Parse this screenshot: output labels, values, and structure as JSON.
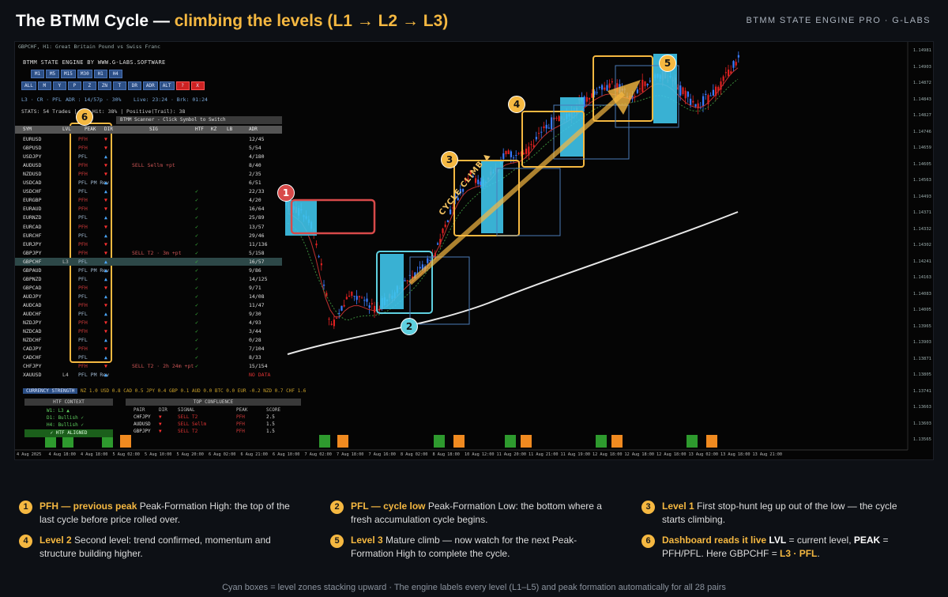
{
  "header": {
    "title_main": "The BTMM Cycle — ",
    "title_accent": "climbing the levels (L1 → L2 → L3)",
    "brand": "BTMM STATE ENGINE PRO · G-LABS"
  },
  "panel": {
    "window_title": "GBPCHF, H1: Great Britain Pound vs Swiss Franc",
    "engine_name": "BTMM STATE ENGINE BY WWW.G-LABS.SOFTWARE",
    "tf_row1": [
      "M1",
      "M5",
      "M15",
      "M30",
      "H1",
      "H4"
    ],
    "tf_row2": [
      "ALL",
      "M",
      "Y",
      "P",
      "Z",
      "ZN",
      "T",
      "DR",
      "ADR",
      "ALT",
      "?",
      "X"
    ],
    "info1": "L3 · CR · PFL",
    "info2": "ADR : 14/57p · 30%",
    "info3": "Live: 23:24 · Brk: 01:24",
    "stats": "STATS: 54 Trades | TP1 Hit: 38% | Positive(Trail): 38",
    "scanner_header": "BTMM Scanner - Click Symbol to Switch",
    "col_headers": [
      "SYM",
      "LVL",
      "PEAK",
      "DIR",
      "SIG",
      "HTF",
      "KZ",
      "LB",
      "ADR"
    ],
    "rows": [
      {
        "sym": "EURUSD",
        "lvl": "",
        "peak": "PFH",
        "dir": "▼",
        "sig": "",
        "htf": "",
        "adr": "12/45"
      },
      {
        "sym": "GBPUSD",
        "lvl": "",
        "peak": "PFH",
        "dir": "▼",
        "sig": "",
        "htf": "",
        "adr": "5/54"
      },
      {
        "sym": "USDJPY",
        "lvl": "",
        "peak": "PFL",
        "dir": "▲",
        "sig": "",
        "htf": "",
        "adr": "4/180"
      },
      {
        "sym": "AUDUSD",
        "lvl": "",
        "peak": "PFH",
        "dir": "▼",
        "sig": "SELL Sellm +pt",
        "htf": "",
        "adr": "8/40"
      },
      {
        "sym": "NZDUSD",
        "lvl": "",
        "peak": "PFH",
        "dir": "▼",
        "sig": "",
        "htf": "",
        "adr": "2/35"
      },
      {
        "sym": "USDCAD",
        "lvl": "",
        "peak": "PFL PM Rev",
        "dir": "▲",
        "sig": "",
        "htf": "",
        "adr": "6/51"
      },
      {
        "sym": "USDCHF",
        "lvl": "",
        "peak": "PFL",
        "dir": "▲",
        "sig": "",
        "htf": "✓",
        "adr": "22/33"
      },
      {
        "sym": "EURGBP",
        "lvl": "",
        "peak": "PFH",
        "dir": "▼",
        "sig": "",
        "htf": "✓",
        "adr": "4/20"
      },
      {
        "sym": "EURAUD",
        "lvl": "",
        "peak": "PFH",
        "dir": "▼",
        "sig": "",
        "htf": "✓",
        "adr": "16/64"
      },
      {
        "sym": "EURNZD",
        "lvl": "",
        "peak": "PFL",
        "dir": "▲",
        "sig": "",
        "htf": "✓",
        "adr": "25/89"
      },
      {
        "sym": "EURCAD",
        "lvl": "",
        "peak": "PFH",
        "dir": "▼",
        "sig": "",
        "htf": "✓",
        "adr": "13/57"
      },
      {
        "sym": "EURCHF",
        "lvl": "",
        "peak": "PFL",
        "dir": "▲",
        "sig": "",
        "htf": "✓",
        "adr": "29/46"
      },
      {
        "sym": "EURJPY",
        "lvl": "",
        "peak": "PFH",
        "dir": "▼",
        "sig": "",
        "htf": "✓",
        "adr": "11/136"
      },
      {
        "sym": "GBPJPY",
        "lvl": "",
        "peak": "PFH",
        "dir": "▼",
        "sig": "SELL T2 · 3m +pt",
        "htf": "✓",
        "adr": "5/158"
      },
      {
        "sym": "GBPCHF",
        "lvl": "L3",
        "peak": "PFL",
        "dir": "▲",
        "sig": "",
        "htf": "✓",
        "adr": "16/57",
        "hl": true
      },
      {
        "sym": "GBPAUD",
        "lvl": "",
        "peak": "PFL PM Rev",
        "dir": "▲",
        "sig": "",
        "htf": "✓",
        "adr": "9/86"
      },
      {
        "sym": "GBPNZD",
        "lvl": "",
        "peak": "PFL",
        "dir": "▲",
        "sig": "",
        "htf": "✓",
        "adr": "14/125"
      },
      {
        "sym": "GBPCAD",
        "lvl": "",
        "peak": "PFH",
        "dir": "▼",
        "sig": "",
        "htf": "✓",
        "adr": "9/71"
      },
      {
        "sym": "AUDJPY",
        "lvl": "",
        "peak": "PFL",
        "dir": "▲",
        "sig": "",
        "htf": "✓",
        "adr": "14/08"
      },
      {
        "sym": "AUDCAD",
        "lvl": "",
        "peak": "PFH",
        "dir": "▼",
        "sig": "",
        "htf": "✓",
        "adr": "11/47"
      },
      {
        "sym": "AUDCHF",
        "lvl": "",
        "peak": "PFL",
        "dir": "▲",
        "sig": "",
        "htf": "✓",
        "adr": "9/30"
      },
      {
        "sym": "NZDJPY",
        "lvl": "",
        "peak": "PFH",
        "dir": "▼",
        "sig": "",
        "htf": "✓",
        "adr": "4/93"
      },
      {
        "sym": "NZDCAD",
        "lvl": "",
        "peak": "PFH",
        "dir": "▼",
        "sig": "",
        "htf": "✓",
        "adr": "3/44"
      },
      {
        "sym": "NZDCHF",
        "lvl": "",
        "peak": "PFL",
        "dir": "▲",
        "sig": "",
        "htf": "✓",
        "adr": "0/28"
      },
      {
        "sym": "CADJPY",
        "lvl": "",
        "peak": "PFH",
        "dir": "▼",
        "sig": "",
        "htf": "✓",
        "adr": "7/104"
      },
      {
        "sym": "CADCHF",
        "lvl": "",
        "peak": "PFL",
        "dir": "▲",
        "sig": "",
        "htf": "✓",
        "adr": "8/33"
      },
      {
        "sym": "CHFJPY",
        "lvl": "",
        "peak": "PFH",
        "dir": "▼",
        "sig": "SELL T2 · 2h 24m +pt",
        "htf": "✓",
        "adr": "15/154"
      },
      {
        "sym": "XAUUSD",
        "lvl": "L4",
        "peak": "PFL PM Rev",
        "dir": "▲",
        "sig": "",
        "htf": "",
        "adr": "NO DATA"
      }
    ],
    "strength_label": "CURRENCY STRENGTH",
    "strength_values": "NZ 1.0 USD 0.8 CAD 0.5 JPY 0.4 GBP 0.1 AUD 0.0 BTC 0.0 EUR -0.2 NZD 0.7 CHF 1.6",
    "htf_header": "HTF CONTEXT",
    "htf_lines": [
      "W1: L3 ▲",
      "D1: Bullish ✓",
      "H4: Bullish ✓"
    ],
    "htf_aligned": "✓ HTF ALIGNED",
    "conf_header": "TOP CONFLUENCE",
    "conf_cols": [
      "PAIR",
      "DIR",
      "SIGNAL",
      "PEAK",
      "SCORE"
    ],
    "conf_rows": [
      {
        "pair": "CHFJPY",
        "dir": "▼",
        "signal": "SELL T2",
        "peak": "PFH",
        "score": "2.5"
      },
      {
        "pair": "AUDUSD",
        "dir": "▼",
        "signal": "SELL Sellm",
        "peak": "PFH",
        "score": "1.5"
      },
      {
        "pair": "GBPJPY",
        "dir": "▼",
        "signal": "SELL T2",
        "peak": "PFH",
        "score": "1.5"
      }
    ]
  },
  "chart": {
    "price_axis": [
      "1.14981",
      "1.14903",
      "1.14872",
      "1.14843",
      "1.14827",
      "1.14746",
      "1.14659",
      "1.14605",
      "1.14563",
      "1.14493",
      "1.14371",
      "1.14332",
      "1.14302",
      "1.14241",
      "1.14163",
      "1.14083",
      "1.14005",
      "1.13965",
      "1.13903",
      "1.13871",
      "1.13805",
      "1.13741",
      "1.13663",
      "1.13603",
      "1.13565"
    ],
    "time_axis": [
      "4 Aug 2025",
      "4 Aug 18:00",
      "4 Aug 18:00",
      "5 Aug 02:00",
      "5 Aug 10:00",
      "5 Aug 20:00",
      "6 Aug 02:00",
      "6 Aug 21:00",
      "6 Aug 10:00",
      "7 Aug 02:00",
      "7 Aug 18:00",
      "7 Aug 16:00",
      "8 Aug 02:00",
      "8 Aug 18:00",
      "10 Aug 12:00",
      "11 Aug 20:00",
      "11 Aug 21:00",
      "11 Aug 19:00",
      "12 Aug 18:00",
      "12 Aug 18:00",
      "12 Aug 18:00",
      "13 Aug 02:00",
      "13 Aug 18:00",
      "13 Aug 21:00"
    ],
    "climb_label": "CYCLE CLIMB ▲",
    "markers": [
      "1",
      "2",
      "3",
      "4",
      "5",
      "6"
    ],
    "accent_color": "#f5b841",
    "zone_color": "#3fc4ea"
  },
  "legend": {
    "items": [
      {
        "num": "1",
        "head": "PFH — previous peak",
        "body": " Peak-Formation High: the top of the last cycle before price rolled over."
      },
      {
        "num": "2",
        "head": "PFL — cycle low",
        "body": " Peak-Formation Low: the bottom where a fresh accumulation cycle begins."
      },
      {
        "num": "3",
        "head": "Level 1",
        "body": " First stop-hunt leg up out of the low — the cycle starts climbing."
      },
      {
        "num": "4",
        "head": "Level 2",
        "body": " Second level: trend confirmed, momentum and structure building higher."
      },
      {
        "num": "5",
        "head": "Level 3",
        "body": " Mature climb — now watch for the next Peak-Formation High to complete the cycle."
      },
      {
        "num": "6",
        "head": "Dashboard reads it live",
        "b1": " LVL",
        "t1": " = current level, ",
        "b2": "PEAK",
        "t2": " = PFH/PFL. Here GBPCHF = ",
        "b3": "L3 · PFL",
        "t3": "."
      }
    ],
    "caption": "Cyan boxes = level zones stacking upward · The engine labels every level (L1–L5) and peak formation automatically for all 28 pairs"
  }
}
